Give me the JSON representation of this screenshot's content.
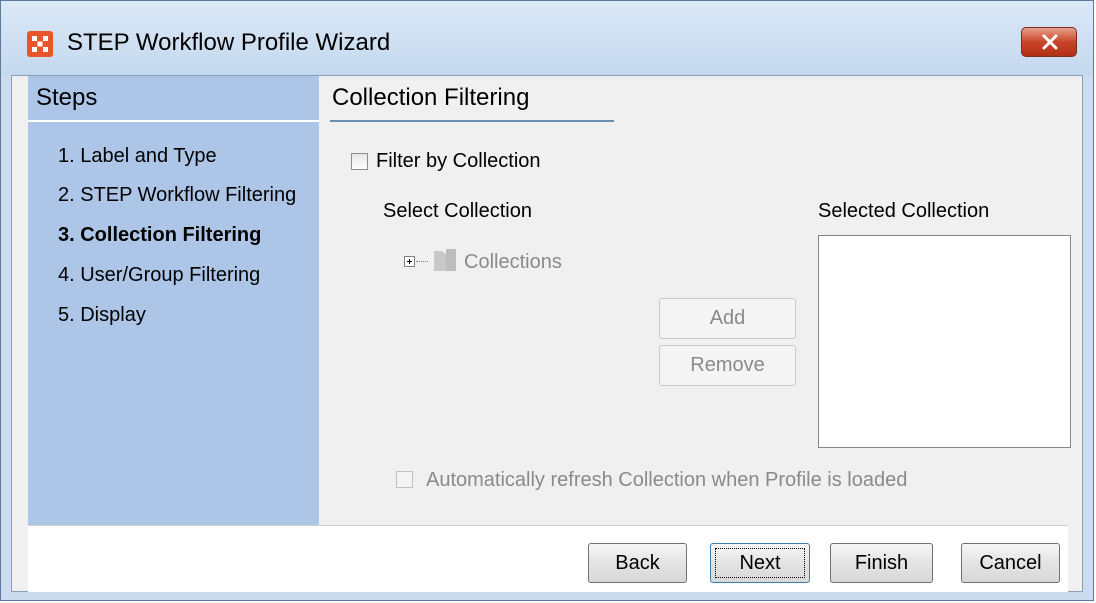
{
  "window": {
    "title": "STEP Workflow Profile Wizard"
  },
  "steps": {
    "title": "Steps",
    "items": [
      {
        "label": "1. Label and Type",
        "active": false
      },
      {
        "label": "2. STEP Workflow Filtering",
        "active": false
      },
      {
        "label": "3. Collection Filtering",
        "active": true
      },
      {
        "label": "4. User/Group Filtering",
        "active": false
      },
      {
        "label": "5. Display",
        "active": false
      }
    ]
  },
  "content": {
    "title": "Collection Filtering",
    "filter_checkbox": {
      "label": "Filter by Collection",
      "checked": false
    },
    "select_collection_label": "Select Collection",
    "selected_collection_label": "Selected Collection",
    "tree": {
      "root_label": "Collections"
    },
    "add_label": "Add",
    "remove_label": "Remove",
    "auto_refresh": {
      "label": "Automatically refresh Collection when Profile is loaded",
      "checked": false
    }
  },
  "footer": {
    "back_label": "Back",
    "next_label": "Next",
    "finish_label": "Finish",
    "cancel_label": "Cancel"
  }
}
